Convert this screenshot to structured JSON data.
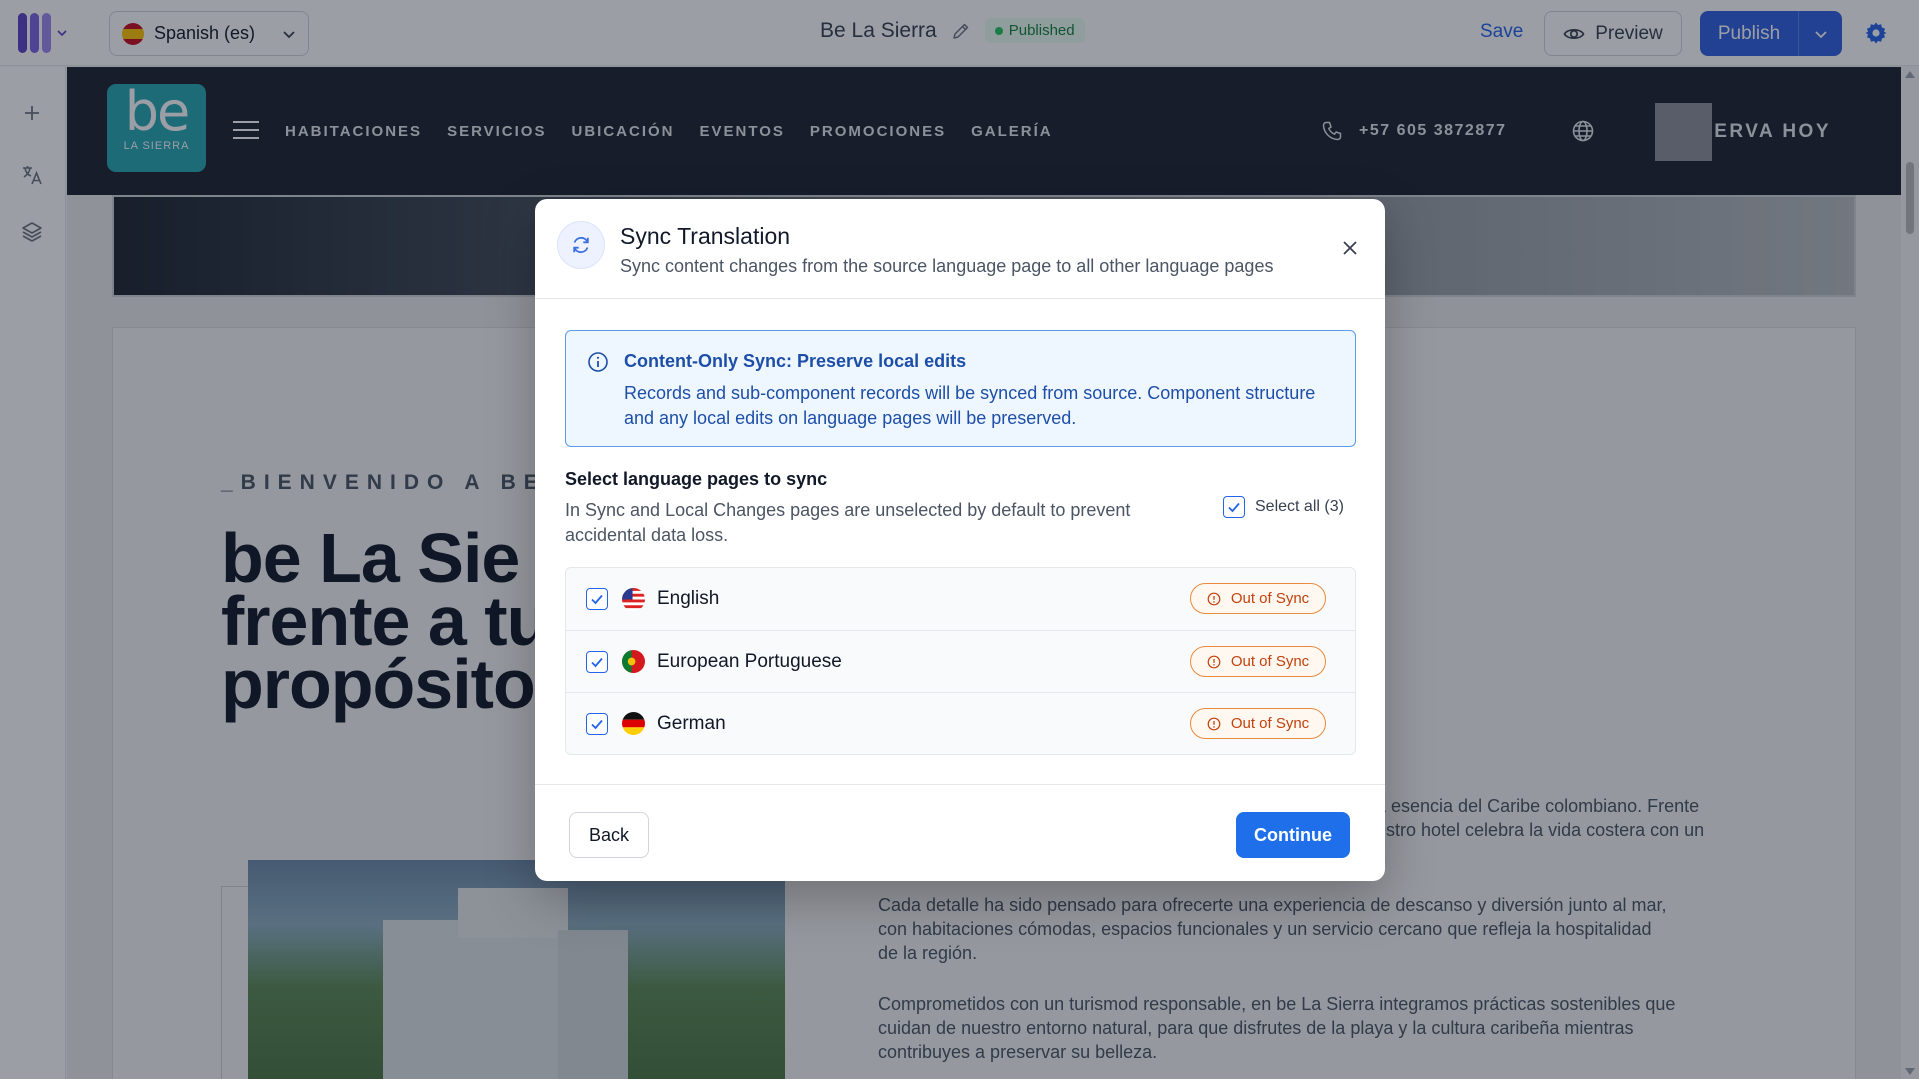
{
  "editor": {
    "language_selector": "Spanish (es)",
    "page_title": "Be La Sierra",
    "status_badge": "Published",
    "save_label": "Save",
    "preview_label": "Preview",
    "publish_label": "Publish",
    "accent_color": "#2f5fe0"
  },
  "site": {
    "logo_text": "be",
    "logo_subtext": "LA SIERRA",
    "nav": [
      "HABITACIONES",
      "SERVICIOS",
      "UBICACIÓN",
      "EVENTOS",
      "PROMOCIONES",
      "GALERÍA"
    ],
    "phone": "+57 605 3872877",
    "reserve_label": "RESERVA HOY",
    "eyebrow": "_BIENVENIDO A BE",
    "hero_title_lines": [
      "be La Sie",
      "frente a tu",
      "propósito"
    ],
    "paragraphs": [
      [
        "a esencia del Caribe colombiano. Frente",
        "estro hotel celebra la vida costera con un"
      ],
      [
        "Cada detalle ha sido pensado para ofrecerte una experiencia de descanso y diversión junto al mar,",
        "con habitaciones cómodas, espacios funcionales y un servicio cercano que refleja la hospitalidad",
        "de la región."
      ],
      [
        "Comprometidos con un turismod responsable, en be La Sierra integramos prácticas sostenibles que",
        "cuidan de nuestro entorno natural, para que disfrutes de la playa y la cultura caribeña mientras",
        "contribuyes a preservar su belleza."
      ]
    ]
  },
  "modal": {
    "title": "Sync Translation",
    "subtitle": "Sync content changes from the source language page to all other language pages",
    "info": {
      "title": "Content-Only Sync:  Preserve local edits",
      "text": "Records and sub-component records will be synced from source. Component structure and any local edits on language pages will be preserved."
    },
    "select_title": "Select language pages to sync",
    "select_desc": "In Sync and Local Changes pages are unselected by default to prevent accidental data loss.",
    "select_all_label": "Select all (3)",
    "languages": [
      {
        "name": "English",
        "status": "Out of Sync",
        "checked": true
      },
      {
        "name": "European Portuguese",
        "status": "Out of Sync",
        "checked": true
      },
      {
        "name": "German",
        "status": "Out of Sync",
        "checked": true
      }
    ],
    "back_label": "Back",
    "continue_label": "Continue"
  }
}
